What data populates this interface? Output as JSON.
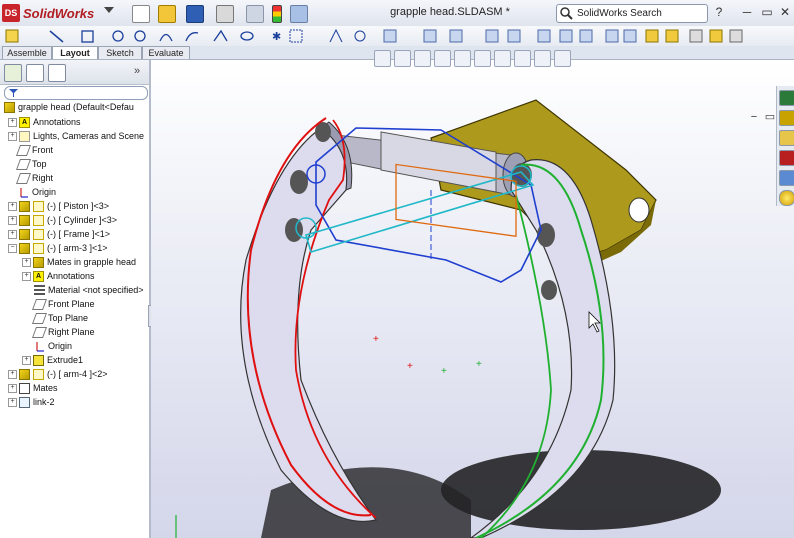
{
  "app": {
    "brand": "SolidWorks",
    "document_title": "grapple head.SLDASM *",
    "search_placeholder": "SolidWorks Search",
    "help_label": "?",
    "colors": {
      "brand": "#c8242b",
      "viewport_top": "#ffffff",
      "viewport_bottom": "#d4d6ea"
    }
  },
  "tabs": [
    {
      "label": "Assemble",
      "active": false
    },
    {
      "label": "Layout",
      "active": true
    },
    {
      "label": "Sketch",
      "active": false
    },
    {
      "label": "Evaluate",
      "active": false
    }
  ],
  "tree": {
    "root": "grapple head  (Default<Defau",
    "items": [
      {
        "label": "Annotations",
        "icon": "annotation-icon"
      },
      {
        "label": "Lights, Cameras and Scene",
        "icon": "lights-icon"
      },
      {
        "label": "Front",
        "icon": "plane-icon"
      },
      {
        "label": "Top",
        "icon": "plane-icon"
      },
      {
        "label": "Right",
        "icon": "plane-icon"
      },
      {
        "label": "Origin",
        "icon": "origin-icon"
      },
      {
        "label": "(-) [ Piston ]<3>",
        "icon": "part-icon"
      },
      {
        "label": "(-) [ Cylinder ]<3>",
        "icon": "part-icon"
      },
      {
        "label": "(-) [ Frame ]<1>",
        "icon": "part-icon"
      },
      {
        "label": "(-) [ arm-3 ]<1>",
        "icon": "part-icon"
      },
      {
        "label": "Mates in grapple head",
        "icon": "mates-icon"
      },
      {
        "label": "Annotations",
        "icon": "annotation-icon"
      },
      {
        "label": "Material <not specified>",
        "icon": "material-icon"
      },
      {
        "label": "Front Plane",
        "icon": "plane-icon"
      },
      {
        "label": "Top Plane",
        "icon": "plane-icon"
      },
      {
        "label": "Right Plane",
        "icon": "plane-icon"
      },
      {
        "label": "Origin",
        "icon": "origin-icon"
      },
      {
        "label": "Extrude1",
        "icon": "extrude-icon"
      },
      {
        "label": "(-) [ arm-4 ]<2>",
        "icon": "part-icon"
      },
      {
        "label": "Mates",
        "icon": "mates-icon"
      },
      {
        "label": "link-2",
        "icon": "sketch-icon"
      }
    ]
  }
}
